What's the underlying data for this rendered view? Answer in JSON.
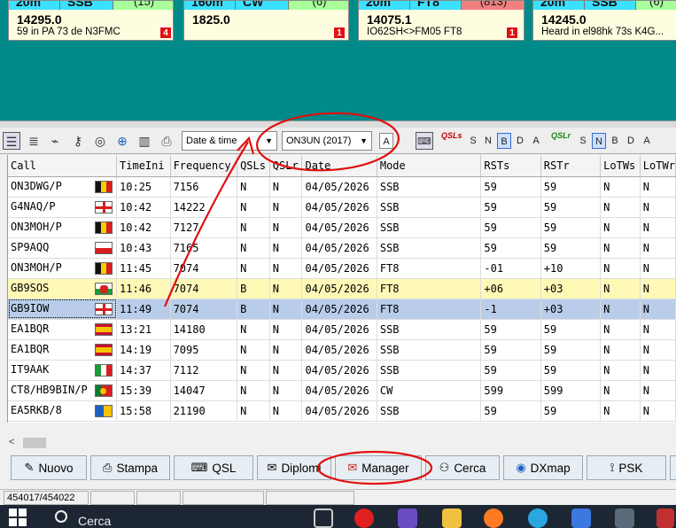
{
  "spots": [
    {
      "band": "20m",
      "mode": "SSB",
      "count": "(15)",
      "freq": "14295.0",
      "msg": "59 in PA 73 de N3FMC",
      "badge": "4"
    },
    {
      "band": "160m",
      "mode": "CW",
      "count": "(6)",
      "freq": "1825.0",
      "msg": "",
      "badge": "1"
    },
    {
      "band": "20m",
      "mode": "FT8",
      "count": "(813)",
      "freq": "14075.1",
      "msg": "IO62SH<>FM05 FT8",
      "badge": "1"
    },
    {
      "band": "20m",
      "mode": "SSB",
      "count": "(6)",
      "freq": "14245.0",
      "msg": "Heard in el98hk 73s K4G...",
      "badge": ""
    }
  ],
  "toolbar": {
    "sort_select": "Date & time",
    "log_select": "ON3UN (2017)",
    "a_label": "A",
    "qsls_flags": [
      "S",
      "N",
      "B",
      "D",
      "A"
    ],
    "qslr_flags": [
      "S",
      "N",
      "B",
      "D",
      "A"
    ],
    "qsls_logo": "QSLs",
    "qslr_logo": "QSLr"
  },
  "table": {
    "columns": [
      "Call",
      "TimeIni",
      "Frequency",
      "QSLs",
      "QSLr",
      "Date",
      "Mode",
      "RSTs",
      "RSTr",
      "LoTWs",
      "LoTWr"
    ],
    "rows": [
      {
        "call": "ON3DWG/P",
        "flag": "belgium",
        "time": "10:25",
        "freq": "7156",
        "qsls": "N",
        "qslr": "N",
        "date": "04/05/2026",
        "mode": "SSB",
        "rsts": "59",
        "rstr": "59",
        "lotws": "N",
        "lotwr": "N"
      },
      {
        "call": "G4NAQ/P",
        "flag": "england",
        "time": "10:42",
        "freq": "14222",
        "qsls": "N",
        "qslr": "N",
        "date": "04/05/2026",
        "mode": "SSB",
        "rsts": "59",
        "rstr": "59",
        "lotws": "N",
        "lotwr": "N"
      },
      {
        "call": "ON3MOH/P",
        "flag": "belgium",
        "time": "10:42",
        "freq": "7127",
        "qsls": "N",
        "qslr": "N",
        "date": "04/05/2026",
        "mode": "SSB",
        "rsts": "59",
        "rstr": "59",
        "lotws": "N",
        "lotwr": "N"
      },
      {
        "call": "SP9AQQ",
        "flag": "poland",
        "time": "10:43",
        "freq": "7165",
        "qsls": "N",
        "qslr": "N",
        "date": "04/05/2026",
        "mode": "SSB",
        "rsts": "59",
        "rstr": "59",
        "lotws": "N",
        "lotwr": "N"
      },
      {
        "call": "ON3MOH/P",
        "flag": "belgium",
        "time": "11:45",
        "freq": "7074",
        "qsls": "N",
        "qslr": "N",
        "date": "04/05/2026",
        "mode": "FT8",
        "rsts": "-01",
        "rstr": "+10",
        "lotws": "N",
        "lotwr": "N"
      },
      {
        "call": "GB9SOS",
        "flag": "wales",
        "time": "11:46",
        "freq": "7074",
        "qsls": "B",
        "qslr": "N",
        "date": "04/05/2026",
        "mode": "FT8",
        "rsts": "+06",
        "rstr": "+03",
        "lotws": "N",
        "lotwr": "N"
      },
      {
        "call": "GB9IOW",
        "flag": "england",
        "time": "11:49",
        "freq": "7074",
        "qsls": "B",
        "qslr": "N",
        "date": "04/05/2026",
        "mode": "FT8",
        "rsts": "-1",
        "rstr": "+03",
        "lotws": "N",
        "lotwr": "N"
      },
      {
        "call": "EA1BQR",
        "flag": "spain",
        "time": "13:21",
        "freq": "14180",
        "qsls": "N",
        "qslr": "N",
        "date": "04/05/2026",
        "mode": "SSB",
        "rsts": "59",
        "rstr": "59",
        "lotws": "N",
        "lotwr": "N"
      },
      {
        "call": "EA1BQR",
        "flag": "spain",
        "time": "14:19",
        "freq": "7095",
        "qsls": "N",
        "qslr": "N",
        "date": "04/05/2026",
        "mode": "SSB",
        "rsts": "59",
        "rstr": "59",
        "lotws": "N",
        "lotwr": "N"
      },
      {
        "call": "IT9AAK",
        "flag": "italy",
        "time": "14:37",
        "freq": "7112",
        "qsls": "N",
        "qslr": "N",
        "date": "04/05/2026",
        "mode": "SSB",
        "rsts": "59",
        "rstr": "59",
        "lotws": "N",
        "lotwr": "N"
      },
      {
        "call": "CT8/HB9BIN/P",
        "flag": "portugal",
        "time": "15:39",
        "freq": "14047",
        "qsls": "N",
        "qslr": "N",
        "date": "04/05/2026",
        "mode": "CW",
        "rsts": "599",
        "rstr": "599",
        "lotws": "N",
        "lotwr": "N"
      },
      {
        "call": "EA5RKB/8",
        "flag": "ukraine",
        "time": "15:58",
        "freq": "21190",
        "qsls": "N",
        "qslr": "N",
        "date": "04/05/2026",
        "mode": "SSB",
        "rsts": "59",
        "rstr": "59",
        "lotws": "N",
        "lotwr": "N"
      }
    ]
  },
  "buttons": {
    "nuovo": "Nuovo",
    "stampa": "Stampa",
    "qsl": "QSL",
    "diplomi": "Diplomi",
    "manager": "Manager",
    "cerca": "Cerca",
    "dxmap": "DXmap",
    "psk": "PSK"
  },
  "statusbar": {
    "count": "454017/454022"
  },
  "taskbar": {
    "search": "Cerca"
  },
  "colors": {
    "accent_teal": "#008a8a",
    "highlight_row": "#fff9b8",
    "selected_row": "#b9cdea",
    "annotation": "#e01010"
  }
}
